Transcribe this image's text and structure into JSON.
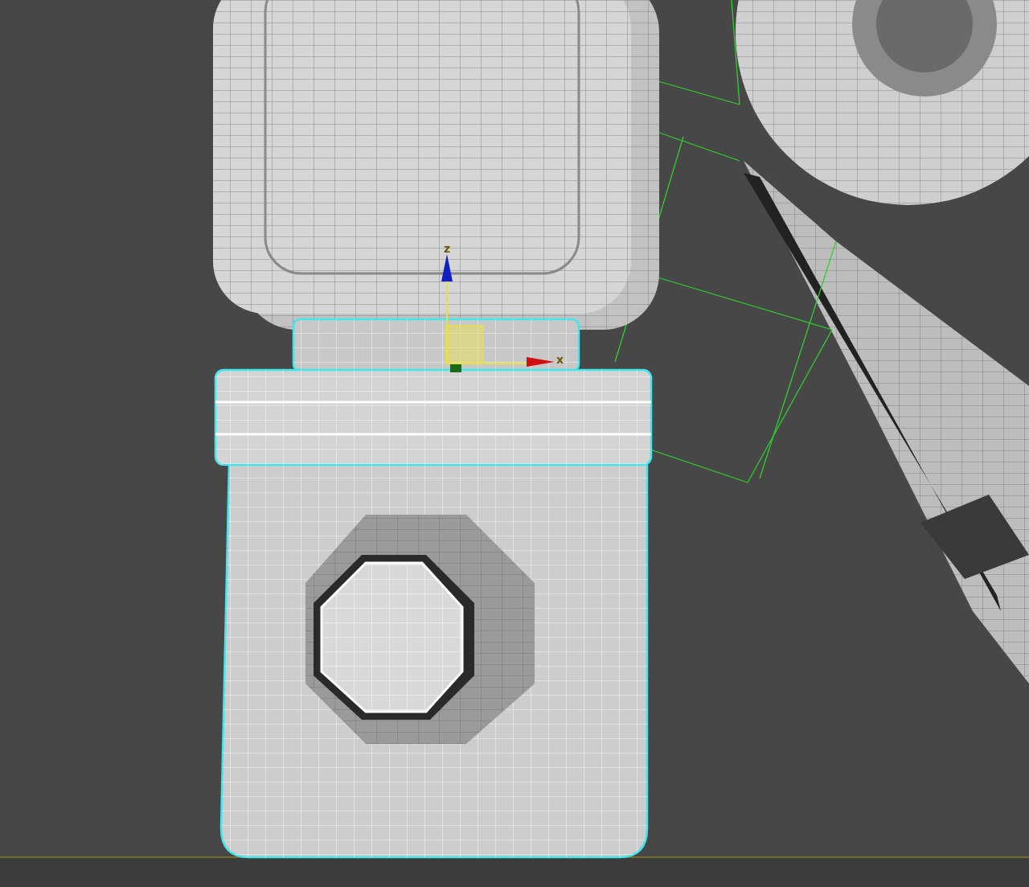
{
  "viewport": {
    "gizmo": {
      "axes": [
        {
          "label": "z",
          "kind": "z"
        },
        {
          "label": "x",
          "kind": "x"
        }
      ]
    }
  }
}
